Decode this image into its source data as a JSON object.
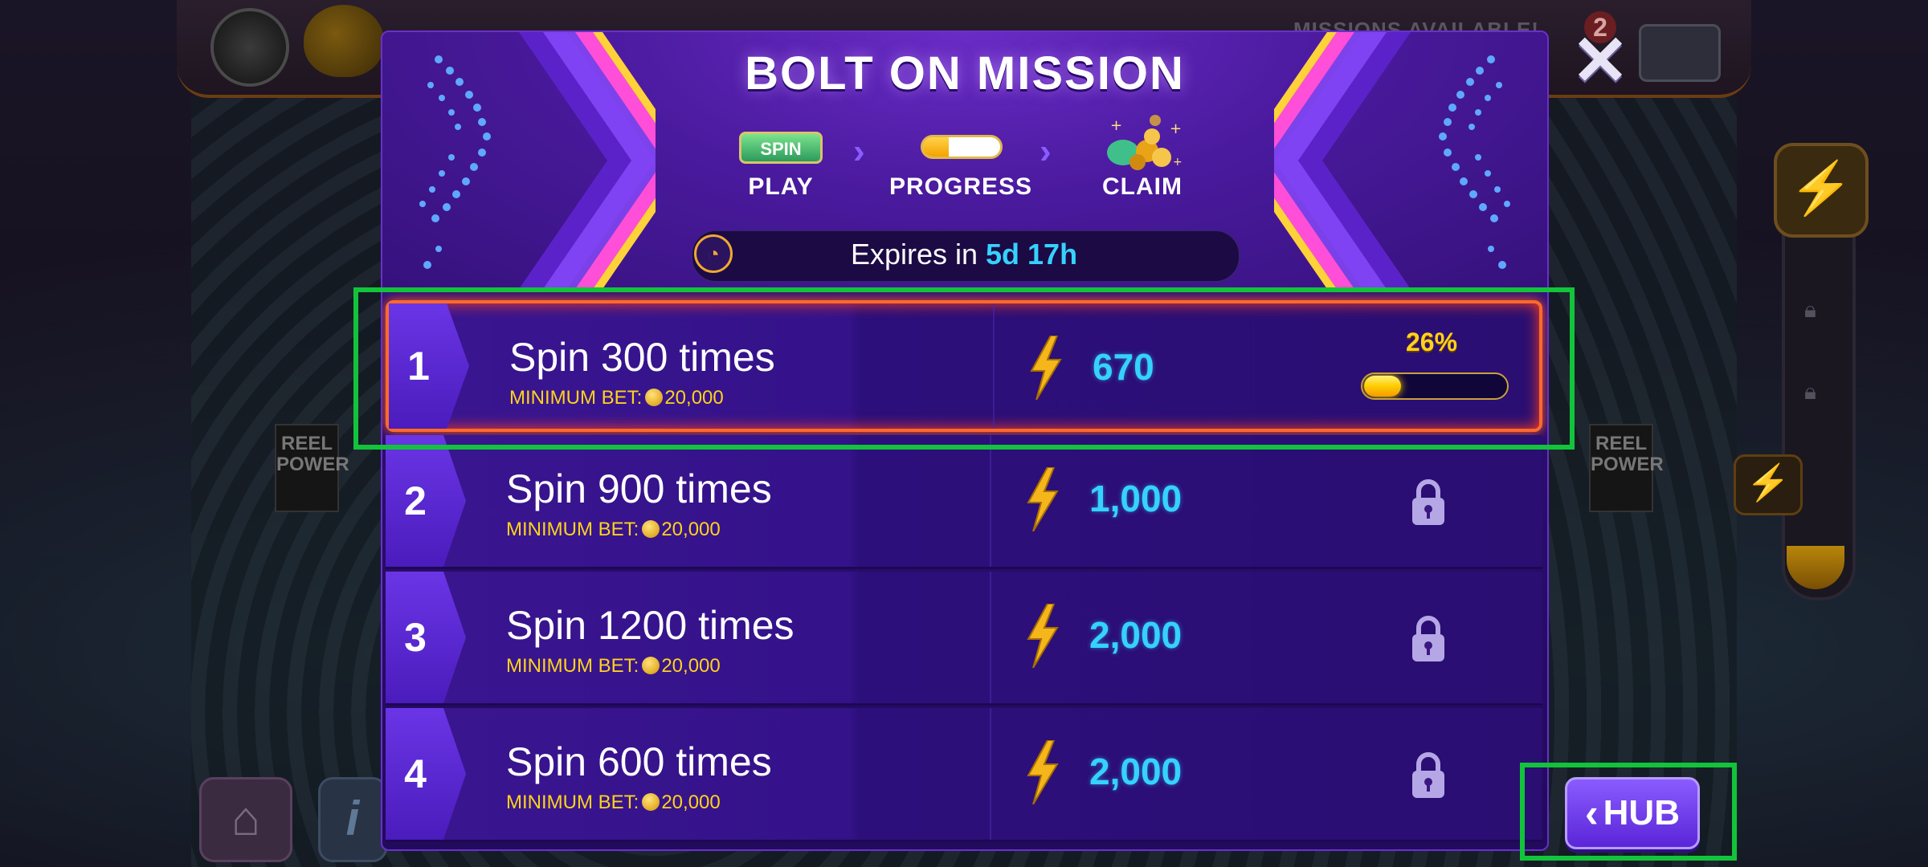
{
  "background": {
    "missions_available_text": "MISSIONS AVAILABLE!",
    "notification_count": "2",
    "reel_power_label": "REEL POWER"
  },
  "modal": {
    "title": "BOLT ON MISSION",
    "steps": {
      "play": {
        "icon_text": "SPIN",
        "label": "PLAY"
      },
      "progress": {
        "label": "PROGRESS",
        "fill_fraction": 0.33
      },
      "claim": {
        "label": "CLAIM"
      }
    },
    "expires": {
      "prefix": "Expires in",
      "value": "5d 17h"
    },
    "missions": [
      {
        "number": "1",
        "title": "Spin 300 times",
        "min_bet_label": "MINIMUM BET:",
        "min_bet_value": "20,000",
        "reward": "670",
        "status": "active",
        "progress_percent": "26%",
        "progress_value": 26
      },
      {
        "number": "2",
        "title": "Spin 900 times",
        "min_bet_label": "MINIMUM BET:",
        "min_bet_value": "20,000",
        "reward": "1,000",
        "status": "locked"
      },
      {
        "number": "3",
        "title": "Spin 1200 times",
        "min_bet_label": "MINIMUM BET:",
        "min_bet_value": "20,000",
        "reward": "2,000",
        "status": "locked"
      },
      {
        "number": "4",
        "title": "Spin 600 times",
        "min_bet_label": "MINIMUM BET:",
        "min_bet_value": "20,000",
        "reward": "2,000",
        "status": "locked"
      }
    ]
  },
  "controls": {
    "close_icon": "close-icon",
    "hub_label": "HUB",
    "hub_icon": "chevron-left-icon"
  },
  "colors": {
    "accent_cyan": "#35d2ff",
    "accent_gold": "#ffd21c",
    "highlight_green": "#12c43a",
    "active_border": "#ff6a2c"
  }
}
